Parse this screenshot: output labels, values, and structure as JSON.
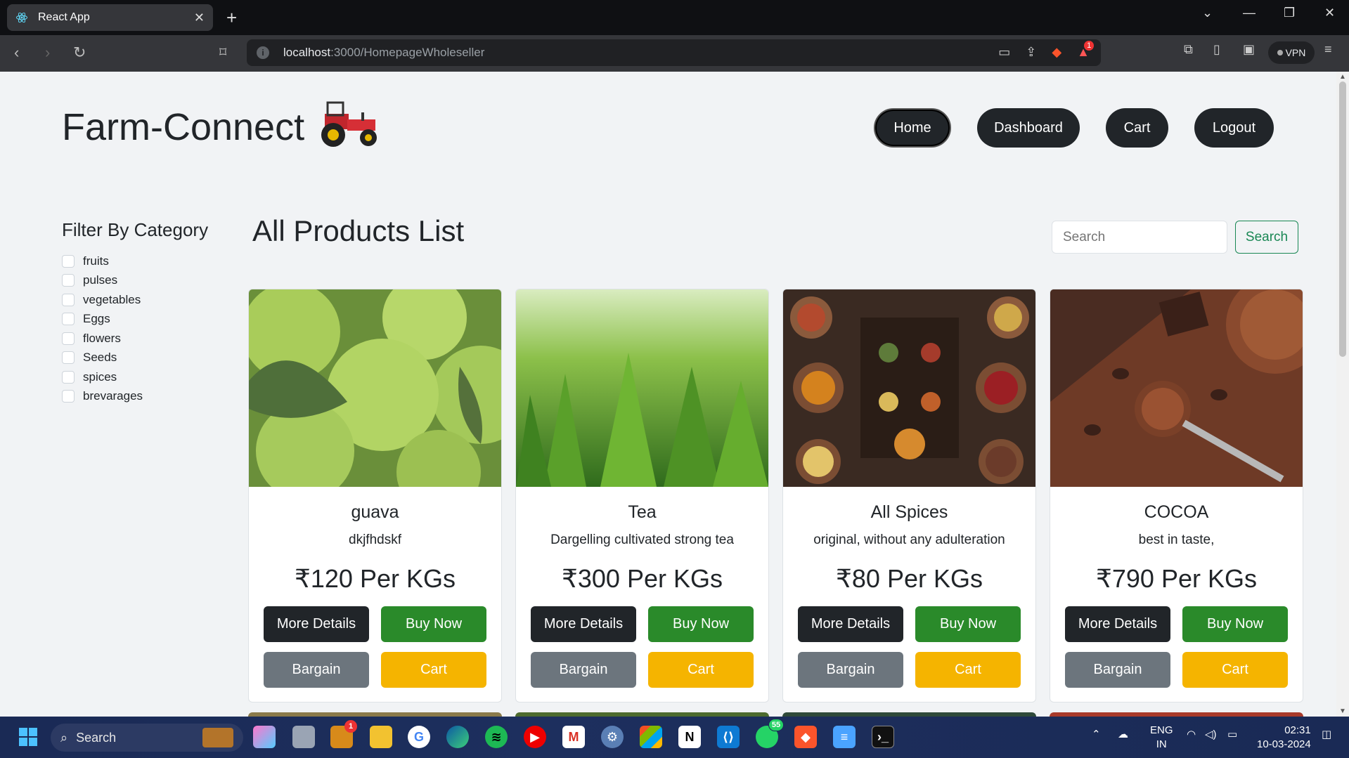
{
  "browser": {
    "tab_title": "React App",
    "tab_close": "✕",
    "new_tab": "+",
    "url_host": "localhost",
    "url_path": ":3000/HomepageWholeseller",
    "vpn_label": "VPN",
    "notif_count": "1"
  },
  "header": {
    "brand": "Farm-Connect",
    "nav": [
      {
        "label": "Home"
      },
      {
        "label": "Dashboard"
      },
      {
        "label": "Cart"
      },
      {
        "label": "Logout"
      }
    ]
  },
  "sidebar": {
    "title": "Filter By Category",
    "categories": [
      {
        "label": "fruits"
      },
      {
        "label": "pulses"
      },
      {
        "label": "vegetables"
      },
      {
        "label": "Eggs"
      },
      {
        "label": "flowers"
      },
      {
        "label": "Seeds"
      },
      {
        "label": "spices"
      },
      {
        "label": "brevarages"
      }
    ]
  },
  "main": {
    "title": "All Products List",
    "search": {
      "placeholder": "Search",
      "button": "Search"
    },
    "products": [
      {
        "name": "guava",
        "desc": "dkjfhdskf",
        "price": "₹120 Per KGs",
        "image": "guava-photo"
      },
      {
        "name": "Tea",
        "desc": "Dargelling cultivated strong tea",
        "price": "₹300 Per KGs",
        "image": "tea-leaves-photo"
      },
      {
        "name": "All Spices",
        "desc": "original, without any adulteration",
        "price": "₹80 Per KGs",
        "image": "spices-photo"
      },
      {
        "name": "COCOA",
        "desc": "best in taste,",
        "price": "₹790 Per KGs",
        "image": "cocoa-photo"
      }
    ],
    "buttons": {
      "details": "More Details",
      "buy": "Buy Now",
      "bargain": "Bargain",
      "cart": "Cart"
    }
  },
  "taskbar": {
    "search_placeholder": "Search",
    "lang_line1": "ENG",
    "lang_line2": "IN",
    "time": "02:31",
    "date": "10-03-2024",
    "whatsapp_badge": "55",
    "mail_badge": "1"
  },
  "colors": {
    "dark": "#212529",
    "green": "#2a8a2a",
    "gray": "#6c757d",
    "yellow": "#f5b400",
    "search_green": "#198754"
  }
}
